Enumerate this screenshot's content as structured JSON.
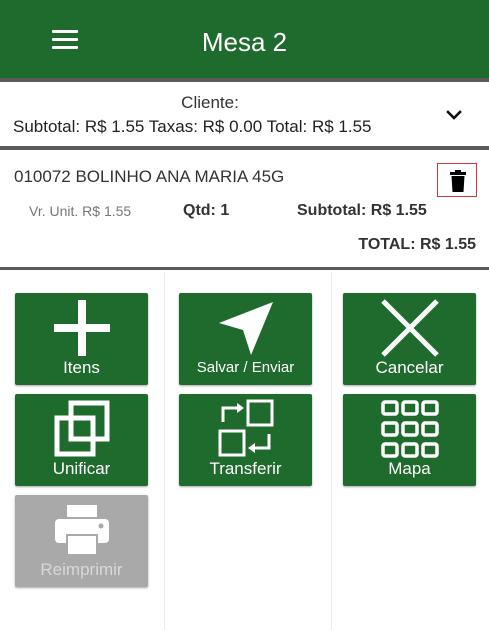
{
  "header": {
    "title": "Mesa 2"
  },
  "client": {
    "label": "Cliente:",
    "totals": "Subtotal: R$ 1.55 Taxas: R$ 0.00 Total: R$ 1.55"
  },
  "item": {
    "name": "010072 BOLINHO ANA MARIA 45G",
    "unit_price": "Vr. Unit. R$ 1.55",
    "quantity": "Qtd: 1",
    "subtotal": "Subtotal: R$ 1.55",
    "total": "TOTAL: R$ 1.55"
  },
  "actions": {
    "itens": "Itens",
    "salvar": "Salvar / Enviar",
    "cancelar": "Cancelar",
    "unificar": "Unificar",
    "transferir": "Transferir",
    "mapa": "Mapa",
    "reimprimir": "Reimprimir"
  },
  "colors": {
    "primary": "#1f6b2e",
    "disabled": "#a9a9a9",
    "delete_outline": "#d23a3a"
  }
}
